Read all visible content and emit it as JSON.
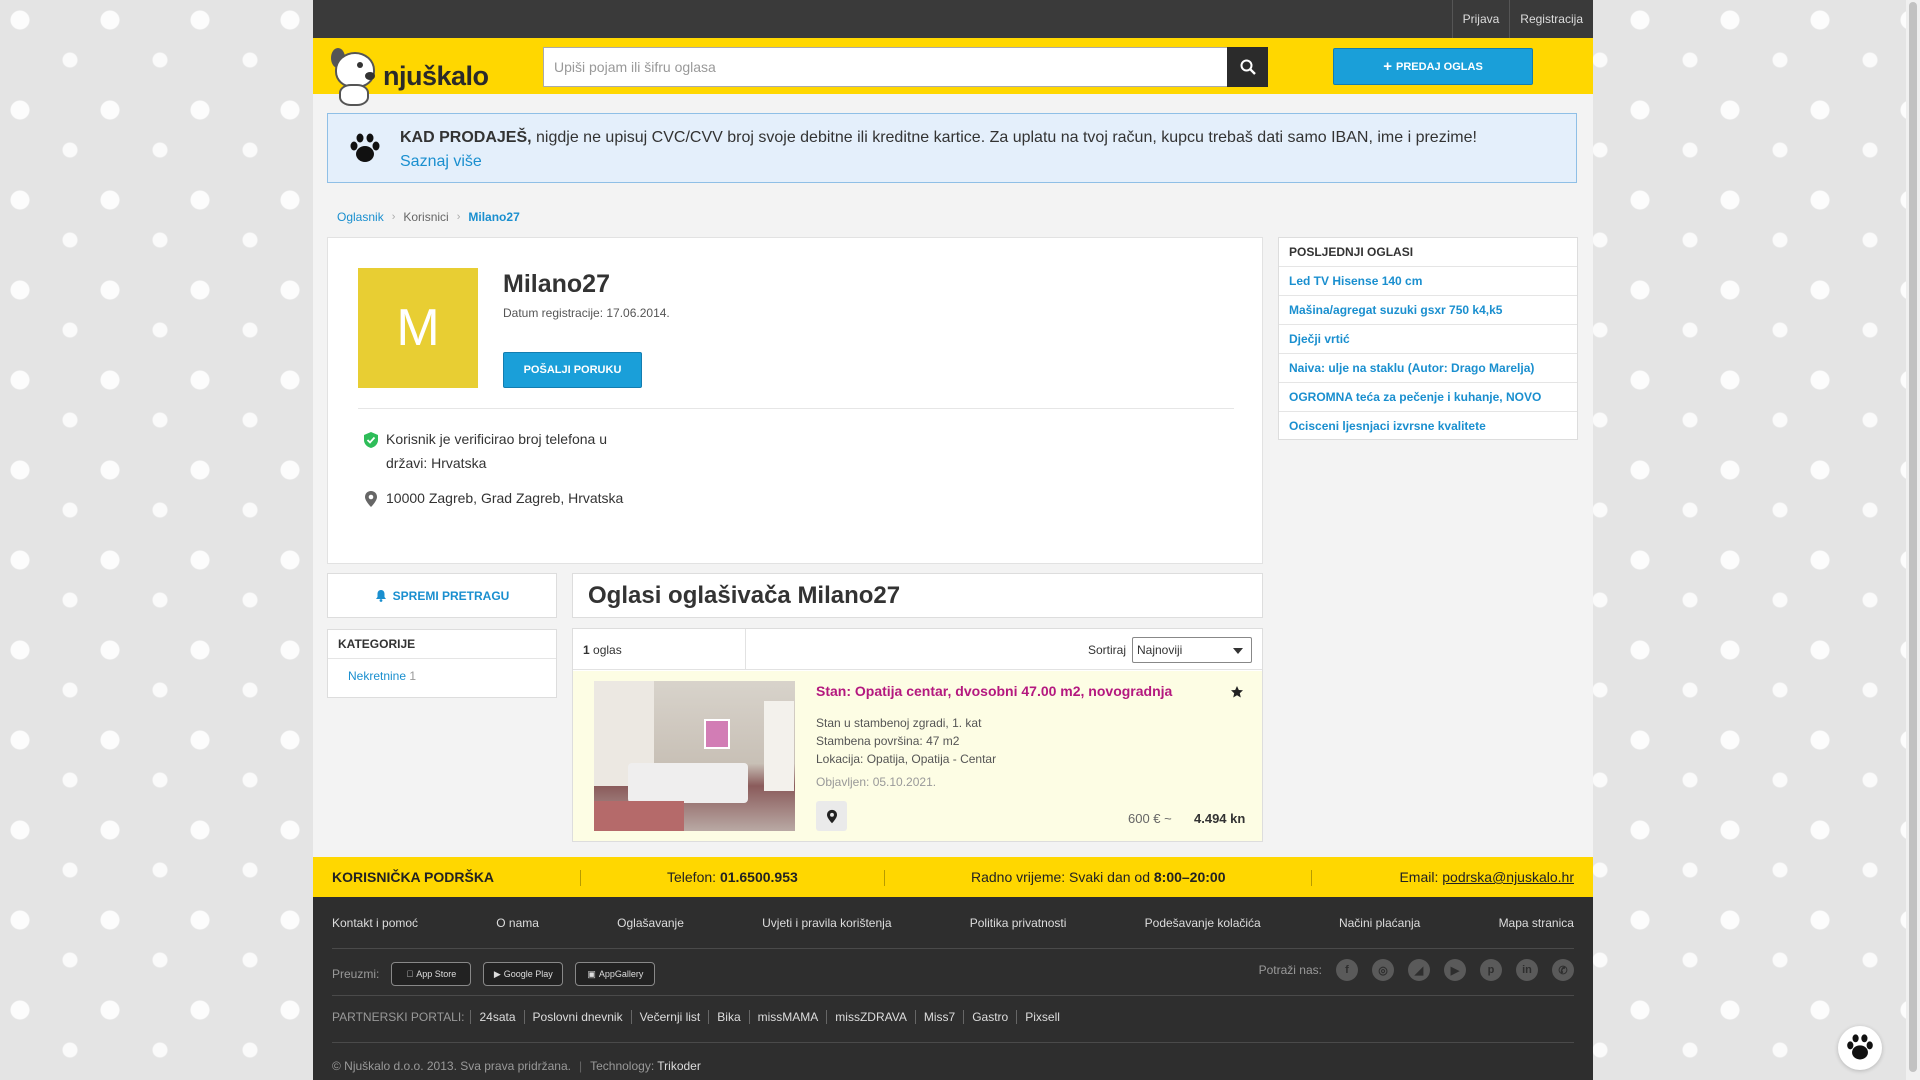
{
  "auth": {
    "login": "Prijava",
    "register": "Registracija"
  },
  "header": {
    "brand": "njuškalo",
    "search_placeholder": "Upiši pojam ili šifru oglasa",
    "post_ad": "PREDAJ OGLAS"
  },
  "notice": {
    "bold": "KAD PRODAJEŠ,",
    "text": " nigdje ne upisuj CVC/CVV broj svoje debitne ili kreditne kartice. Za uplatu na tvoj račun, kupcu trebaš dati samo IBAN, ime i prezime!",
    "link": "Saznaj više"
  },
  "breadcrumb": [
    "Oglasnik",
    "Korisnici",
    "Milano27"
  ],
  "profile": {
    "initial": "M",
    "name": "Milano27",
    "reg_date": "Datum registracije: 17.06.2014.",
    "message_btn": "POŠALJI PORUKU",
    "verified": "Korisnik je verificirao broj telefona u državi: Hrvatska",
    "location": "10000 Zagreb, Grad Zagreb, Hrvatska"
  },
  "sidebar": {
    "save_search": "SPREMI PRETRAGU",
    "categories_title": "KATEGORIJE",
    "categories": [
      {
        "label": "Nekretnine",
        "count": "1"
      }
    ]
  },
  "ads": {
    "title": "Oglasi oglašivača Milano27",
    "count_num": "1",
    "count_label": " oglas",
    "sort_label": "Sortiraj",
    "sort_value": "Najnoviji",
    "items": [
      {
        "title": "Stan: Opatija centar, dvosobni 47.00 m2, novogradnja",
        "line1": "Stan u stambenoj zgradi, 1. kat",
        "line2": "Stambena površina: 47 m2",
        "line3": "Lokacija: Opatija, Opatija - Centar",
        "published": "Objavljen: 05.10.2021.",
        "price_eur": "600 € ~",
        "price_kn": "4.494 kn"
      }
    ]
  },
  "latest": {
    "title": "POSLJEDNJI OGLASI",
    "items": [
      "Led TV Hisense 140 cm",
      "Mašina/agregat suzuki gsxr 750 k4,k5",
      "Dječji vrtić",
      "Naiva: ulje na staklu (Autor: Drago Marelja)",
      "OGROMNA teća za pečenje i kuhanje, NOVO",
      "Ocisceni ljesnjaci izvrsne kvalitete"
    ]
  },
  "support": {
    "title": "KORISNIČKA PODRŠKA",
    "phone_label": "Telefon: ",
    "phone": "01.6500.953",
    "hours_label": "Radno vrijeme: Svaki dan od ",
    "hours": "8:00–20:00",
    "email_label": "Email: ",
    "email": "podrska@njuskalo.hr"
  },
  "footer": {
    "links": [
      "Kontakt i pomoć",
      "O nama",
      "Oglašavanje",
      "Uvjeti i pravila korištenja",
      "Politika privatnosti",
      "Podešavanje kolačića",
      "Načini plaćanja",
      "Mapa stranica"
    ],
    "download_label": "Preuzmi:",
    "stores": [
      "App Store",
      "Google Play",
      "AppGallery"
    ],
    "follow_label": "Potraži nas:",
    "partners_label": "PARTNERSKI PORTALI:",
    "partners": [
      "24sata",
      "Poslovni dnevnik",
      "Večernji list",
      "Bika",
      "missMAMA",
      "missZDRAVA",
      "Miss7",
      "Gastro",
      "Pixsell"
    ],
    "copyright": "© Njuškalo d.o.o. 2013. Sva prava pridržana.",
    "tech_label": "Technology: ",
    "tech": "Trikoder"
  },
  "colors": {
    "brand_yellow": "#ffd700",
    "link_blue": "#1a8fcf",
    "ad_title": "#b4187f",
    "avatar": "#e8ce33"
  }
}
